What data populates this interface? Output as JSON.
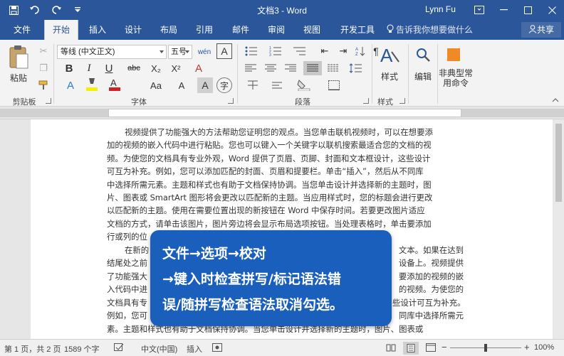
{
  "titlebar": {
    "document_title": "文档3 - Word",
    "user_name": "Lynn Fu",
    "qat": [
      "save-icon",
      "undo-icon",
      "redo-icon",
      "customize-qat-icon"
    ],
    "window_controls": [
      "ribbon-display-icon",
      "minimize-icon",
      "restore-icon",
      "close-icon"
    ]
  },
  "tabs": [
    "文件",
    "开始",
    "插入",
    "设计",
    "布局",
    "引用",
    "邮件",
    "审阅",
    "视图",
    "开发工具"
  ],
  "active_tab": "开始",
  "tell_me": "告诉我你想要做什么",
  "share": "共享",
  "ribbon": {
    "clipboard": {
      "paste": "粘贴",
      "group_label": "剪贴板"
    },
    "font": {
      "font_name": "等线 (中文正文)",
      "font_size": "五号",
      "group_label": "字体",
      "bold": "B",
      "italic": "I",
      "underline": "U",
      "strike": "abc",
      "subscript": "X₂",
      "superscript": "X²",
      "clear": "A",
      "font_color": "A",
      "char_shade": "A",
      "char_border": "A",
      "pinyin": "wén"
    },
    "paragraph": {
      "group_label": "段落"
    },
    "styles": {
      "styles": "样式",
      "group_label": "样式"
    },
    "editing": {
      "editing": "编辑"
    },
    "special": {
      "label_line1": "非典型常",
      "label_line2": "用命令"
    }
  },
  "document": {
    "para1": [
      "视频提供了功能强大的方法帮助您证明您的观点。当您单击联机视频时，可以在想要添",
      "加的视频的嵌入代码中进行粘贴。您也可以键入一个关键字以联机搜索最适合您的文档的视",
      "频。为使您的文档具有专业外观，Word 提供了页眉、页脚、封面和文本框设计，这些设计",
      "可互为补充。例如，您可以添加匹配的封面、页眉和提要栏。单击“插入”，然后从不同库",
      "中选择所需元素。主题和样式也有助于文档保持协调。当您单击设计并选择新的主题时，图",
      "片、图表或 SmartArt 图形将会更改以匹配新的主题。当应用样式时，您的标题会进行更改",
      "以匹配新的主题。使用在需要位置出现的新按钮在 Word 中保存时间。若要更改图片适应",
      "文档的方式，请单击该图片，图片旁边将会显示布局选项按钮。当处理表格时，单击要添加",
      "行或列的位"
    ],
    "para2_fragments": [
      "在新的",
      "文本。如果在达到",
      "结尾处之前",
      "设备上。视频提供",
      "了功能强大",
      "要添加的视频的嵌",
      "入代码中进",
      "的视频。为使您的",
      "文档具有专",
      "些设计可互为补充。",
      "例如，您可",
      "同库中选择所需元"
    ],
    "last_line": "素。主题和样式也有助于文档保持协调。当您单击设计并选择新的主题时，图片、图表或"
  },
  "callout": {
    "line1": "文件→选项→校对",
    "line2": "→键入时检查拼写/标记语法错",
    "line3": "误/随拼写检查语法取消勾选。"
  },
  "statusbar": {
    "page": "第 1 页，共 2 页",
    "words": "1589 个字",
    "language": "中文(中国)",
    "mode": "插入",
    "zoom": "100%",
    "zoom_percent": 100
  },
  "colors": {
    "title_bar": "#2b579a",
    "callout": "#1b5fbd"
  }
}
